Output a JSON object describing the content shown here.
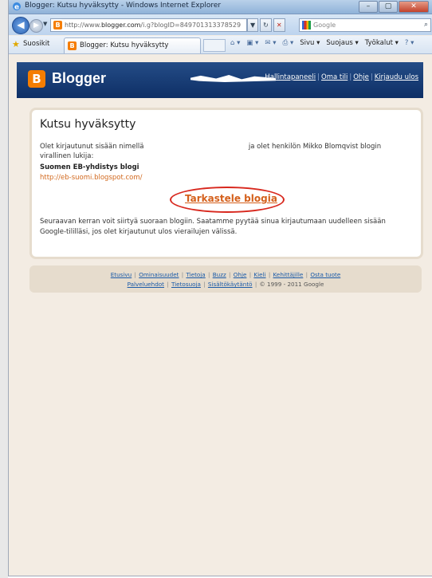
{
  "window": {
    "title": "Blogger: Kutsu hyväksytty - Windows Internet Explorer",
    "address_host": "http://www.",
    "address_domain": "blogger.com",
    "address_path": "/i.g?blogID=849701313378529",
    "search_placeholder": "Google",
    "minimize_glyph": "–",
    "maximize_glyph": "▢",
    "close_glyph": "✕"
  },
  "favorites_bar": {
    "favorites_label": "Suosikit",
    "tab_title": "Blogger: Kutsu hyväksytty",
    "page_menu": "Sivu",
    "safety_menu": "Suojaus",
    "tools_menu": "Työkalut"
  },
  "header": {
    "brand": "Blogger",
    "links": [
      "Hallintapaneeli",
      "Oma tili",
      "Ohje",
      "Kirjaudu ulos"
    ]
  },
  "main": {
    "heading": "Kutsu hyväksytty",
    "signed_in_prefix": "Olet kirjautunut sisään nimellä",
    "signed_in_suffix": "ja olet henkilön Mikko Blomqvist blogin virallinen lukija:",
    "blog_name": "Suomen EB-yhdistys blogi",
    "blog_url": "http://eb-suomi.blogspot.com/",
    "view_blog_link": "Tarkastele blogia",
    "next_time_text": "Seuraavan kerran voit siirtyä suoraan blogiin. Saatamme pyytää sinua kirjautumaan uudelleen sisään Google-tililläsi, jos olet kirjautunut ulos vierailujen välissä."
  },
  "footer": {
    "row1": [
      "Etusivu",
      "Ominaisuudet",
      "Tietoja",
      "Buzz",
      "Ohje",
      "Kieli",
      "Kehittäjille",
      "Osta tuote"
    ],
    "row2_links": [
      "Palveluehdot",
      "Tietosuoja",
      "Sisältökäytäntö"
    ],
    "copyright": "© 1999 - 2011 Google"
  },
  "colors": {
    "accent": "#f57d00",
    "header_bg": "#1b3f78",
    "link": "#1a5aa8",
    "highlight_ring": "#d8281e"
  }
}
